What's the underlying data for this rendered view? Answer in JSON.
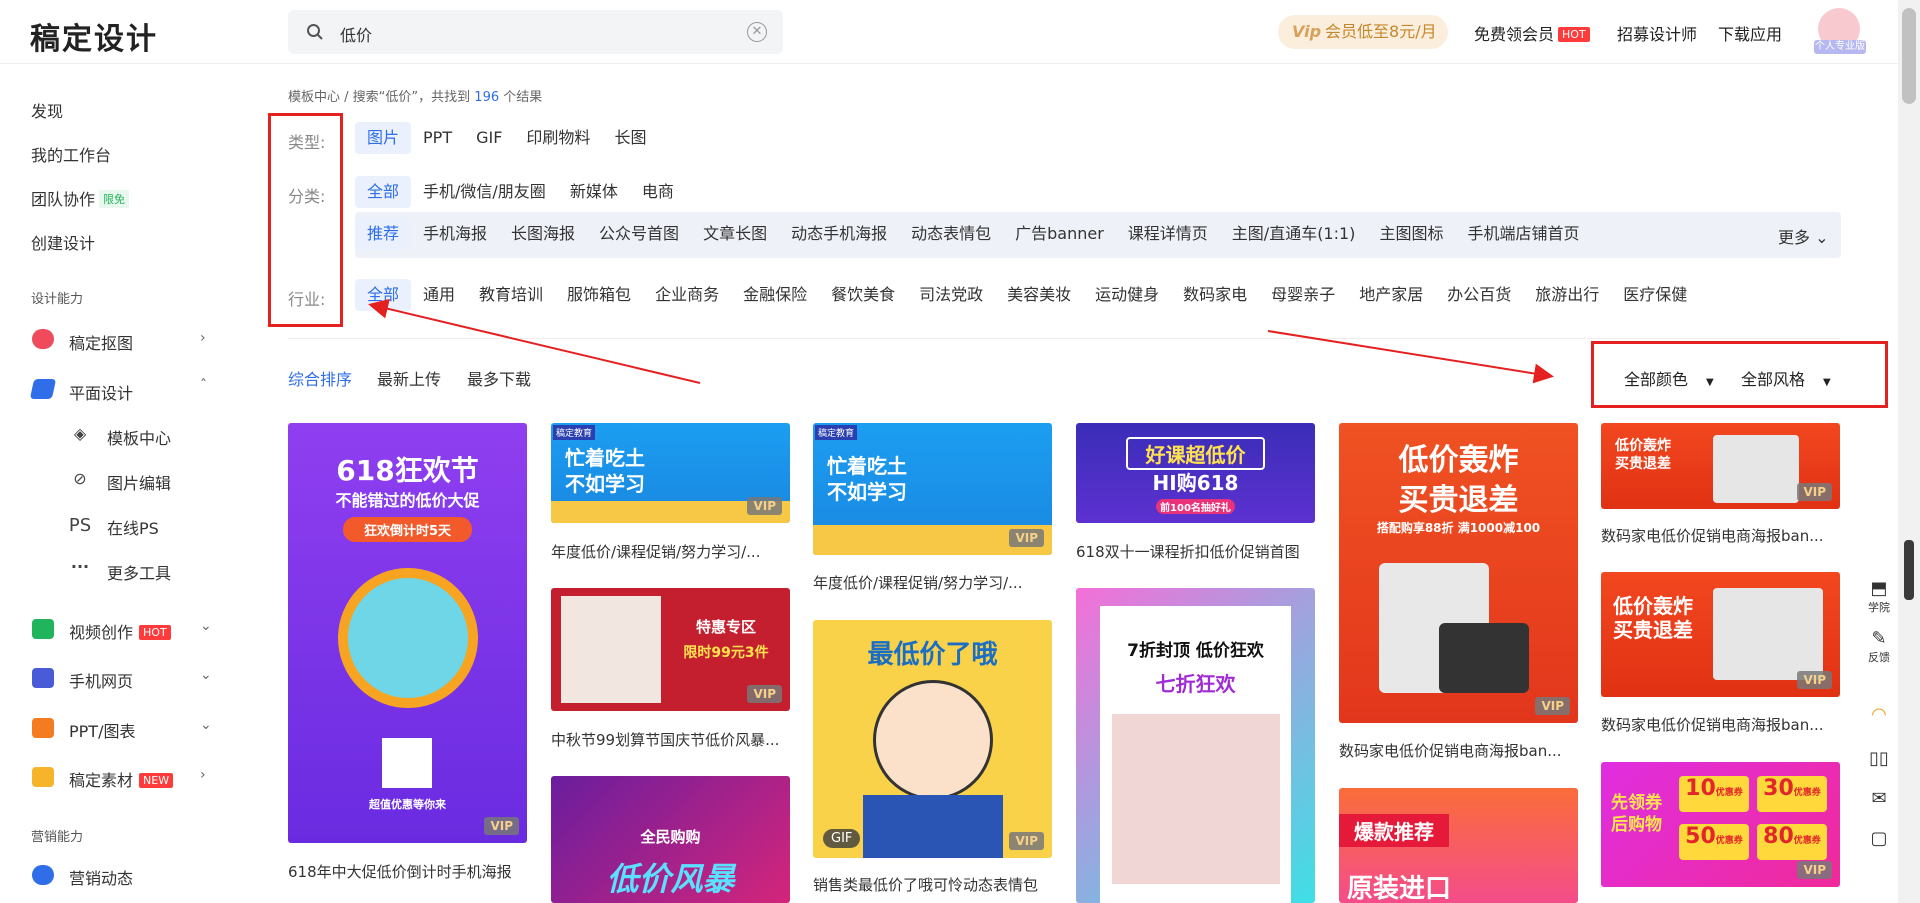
{
  "header": {
    "logo": "稿定设计",
    "search_value": "低价",
    "vip_pill": "会员低至8元/月",
    "vip_mark": "Vip",
    "free_vip": "免费领会员",
    "hot": "HOT",
    "recruit": "招募设计师",
    "download": "下载应用",
    "avatar_label": "个人专业版"
  },
  "sidebar": {
    "discover": "发现",
    "workspace": "我的工作台",
    "team": "团队协作",
    "team_badge": "限免",
    "create": "创建设计",
    "section_design": "设计能力",
    "cutout": "稿定抠图",
    "graphic": "平面设计",
    "templates": "模板中心",
    "image_edit": "图片编辑",
    "online_ps": "在线PS",
    "ps_mark": "PS",
    "more_tools": "更多工具",
    "video": "视频创作",
    "video_badge": "HOT",
    "h5": "手机网页",
    "ppt": "PPT/图表",
    "material": "稿定素材",
    "material_badge": "NEW",
    "section_marketing": "营销能力",
    "marketing": "营销动态"
  },
  "breadcrumb": {
    "root": "模板中心",
    "sep": " / ",
    "prefix": "搜索“低价”，共找到",
    "count": "196",
    "suffix": "个结果"
  },
  "filters": {
    "type_label": "类型:",
    "types": [
      "图片",
      "PPT",
      "GIF",
      "印刷物料",
      "长图"
    ],
    "category_label": "分类:",
    "categories": [
      "全部",
      "手机/微信/朋友圈",
      "新媒体",
      "电商"
    ],
    "subcategories": [
      "推荐",
      "手机海报",
      "长图海报",
      "公众号首图",
      "文章长图",
      "动态手机海报",
      "动态表情包",
      "广告banner",
      "课程详情页",
      "主图/直通车(1:1)",
      "主图图标",
      "手机端店铺首页"
    ],
    "more": "更多",
    "industry_label": "行业:",
    "industries": [
      "全部",
      "通用",
      "教育培训",
      "服饰箱包",
      "企业商务",
      "金融保险",
      "餐饮美食",
      "司法党政",
      "美容美妆",
      "运动健身",
      "数码家电",
      "母婴亲子",
      "地产家居",
      "办公百货",
      "旅游出行",
      "医疗保健"
    ]
  },
  "sort": {
    "comprehensive": "综合排序",
    "latest": "最新上传",
    "most_download": "最多下载",
    "all_colors": "全部颜色",
    "all_styles": "全部风格"
  },
  "cards": {
    "c1_title": "618年中大促低价倒计时手机海报",
    "c1_h1": "618狂欢节",
    "c1_h2": "不能错过的低价大促",
    "c1_h3": "狂欢倒计时5天",
    "c1_h4": "超值优惠等你来",
    "c2_title": "年度低价/课程促销/努力学习/...",
    "c2_text": "忙着吃土 不如学习",
    "c3_title": "中秋节99划算节国庆节低价风暴...",
    "c3_h1": "特惠专区",
    "c3_h2": "限时99元3件",
    "c4_text": "全民购购",
    "c4_big": "低价风暴",
    "c5_title": "年度低价/课程促销/努力学习/...",
    "c5_text": "忙着吃土 不如学习",
    "c6_title": "销售类最低价了哦可怜动态表情包",
    "c6_text": "最低价了哦",
    "c7_title": "618双十一课程折扣低价促销首图",
    "c7_h1": "好课超低价",
    "c7_h2": "HI购618",
    "c7_h3": "前100名抽好礼",
    "c8_h1": "7折封顶 低价狂欢",
    "c8_h2": "七折狂欢",
    "c9_title": "数码家电低价促销电商海报ban...",
    "c9_h1": "低价轰炸",
    "c9_h2": "买贵退差",
    "c9_h3": "搭配购享88折 满1000减100",
    "c10_h1": "爆款推荐",
    "c10_h2": "原装进口",
    "c11_title": "数码家电低价促销电商海报ban...",
    "c11_text": "低价轰炸 买贵退差",
    "c12_title": "数码家电低价促销电商海报ban...",
    "c12_text": "低价轰炸 买贵退差",
    "c13_h1": "先领券后购物",
    "c13_v1": "10",
    "c13_v2": "30",
    "c13_v3": "50",
    "c13_v4": "80",
    "c13_label": "优惠券",
    "corner": "稿定教育",
    "vip": "VIP",
    "gif": "GIF"
  },
  "rail": {
    "academy": "学院",
    "feedback": "反馈"
  },
  "colors": {
    "accent": "#2f6ee8",
    "annotation_red": "#e52020"
  }
}
